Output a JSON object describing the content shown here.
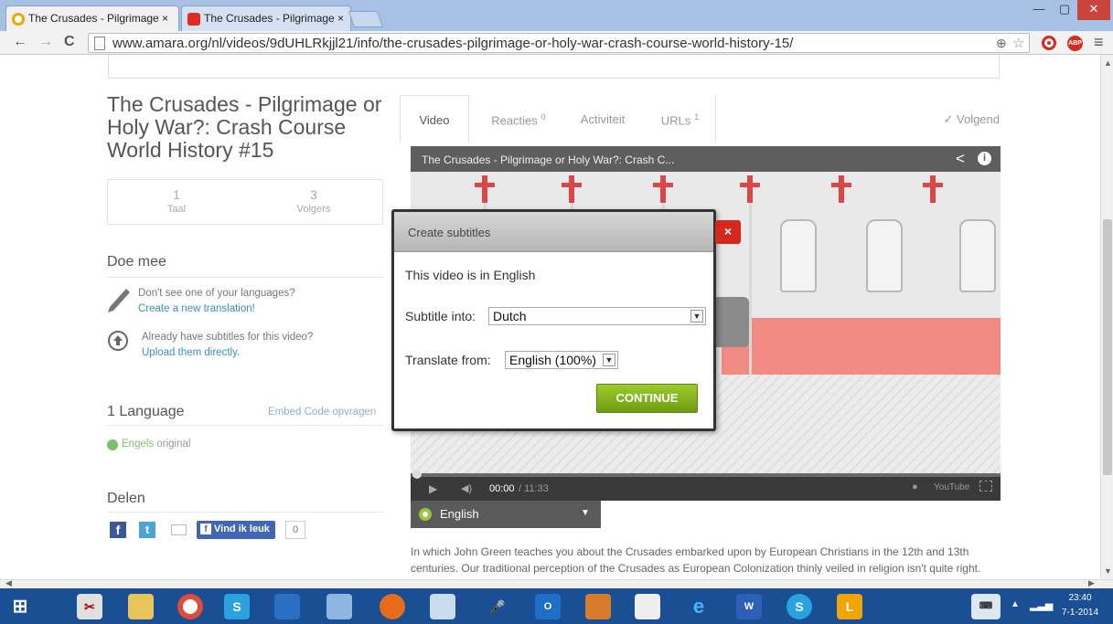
{
  "browser": {
    "tabs": [
      {
        "title": "The Crusades - Pilgrimage ×",
        "active": true
      },
      {
        "title": "The Crusades - Pilgrimage ×",
        "active": false
      }
    ],
    "url": "www.amara.org/nl/videos/9dUHLRkjjl21/info/the-crusades-pilgrimage-or-holy-war-crash-course-world-history-15/",
    "window_buttons": {
      "minimize": "—",
      "maximize": "▢",
      "close": "✕"
    },
    "nav": {
      "back": "←",
      "forward": "→",
      "reload": "C"
    }
  },
  "video_title": "The Crusades - Pilgrimage or Holy War?: Crash Course World History #15",
  "stats": [
    {
      "number": "1",
      "label": "Taal"
    },
    {
      "number": "3",
      "label": "Volgers"
    }
  ],
  "join": {
    "heading": "Doe mee",
    "item1_text": "Don't see one of your languages?",
    "item1_link": "Create a new translation!",
    "item2_text": "Already have subtitles for this video?",
    "item2_link": "Upload them directly."
  },
  "languages": {
    "heading": "1 Language",
    "embed_link": "Embed Code opvragen",
    "items": [
      {
        "name": "Engels",
        "note": "original"
      }
    ]
  },
  "share": {
    "heading": "Delen",
    "like_button": "Vind ik leuk",
    "like_count": "0"
  },
  "video_tabs": [
    {
      "label": "Video",
      "count": ""
    },
    {
      "label": "Reacties",
      "count": "0"
    },
    {
      "label": "Activiteit",
      "count": ""
    },
    {
      "label": "URLs",
      "count": "1"
    }
  ],
  "follow_label": "✓ Volgend",
  "player": {
    "title": "The Crusades - Pilgrimage or Holy War?: Crash C...",
    "time_current": "00:00",
    "time_total": "/ 11:33",
    "brand": "YouTube"
  },
  "subtitle_language": "English",
  "description": "In which John Green teaches you about the Crusades embarked upon by European Christians in the 12th and 13th centuries. Our traditional perception of the Crusades as European Colonization thinly veiled in religion isn't quite right.",
  "modal": {
    "title": "Create subtitles",
    "close": "×",
    "video_language_text": "This video is in English",
    "subtitle_into_label": "Subtitle into:",
    "subtitle_into_value": "Dutch",
    "translate_from_label": "Translate from:",
    "translate_from_value": "English (100%)",
    "continue_button": "CONTINUE"
  },
  "taskbar": {
    "time": "23:40",
    "date": "7-1-2014"
  }
}
